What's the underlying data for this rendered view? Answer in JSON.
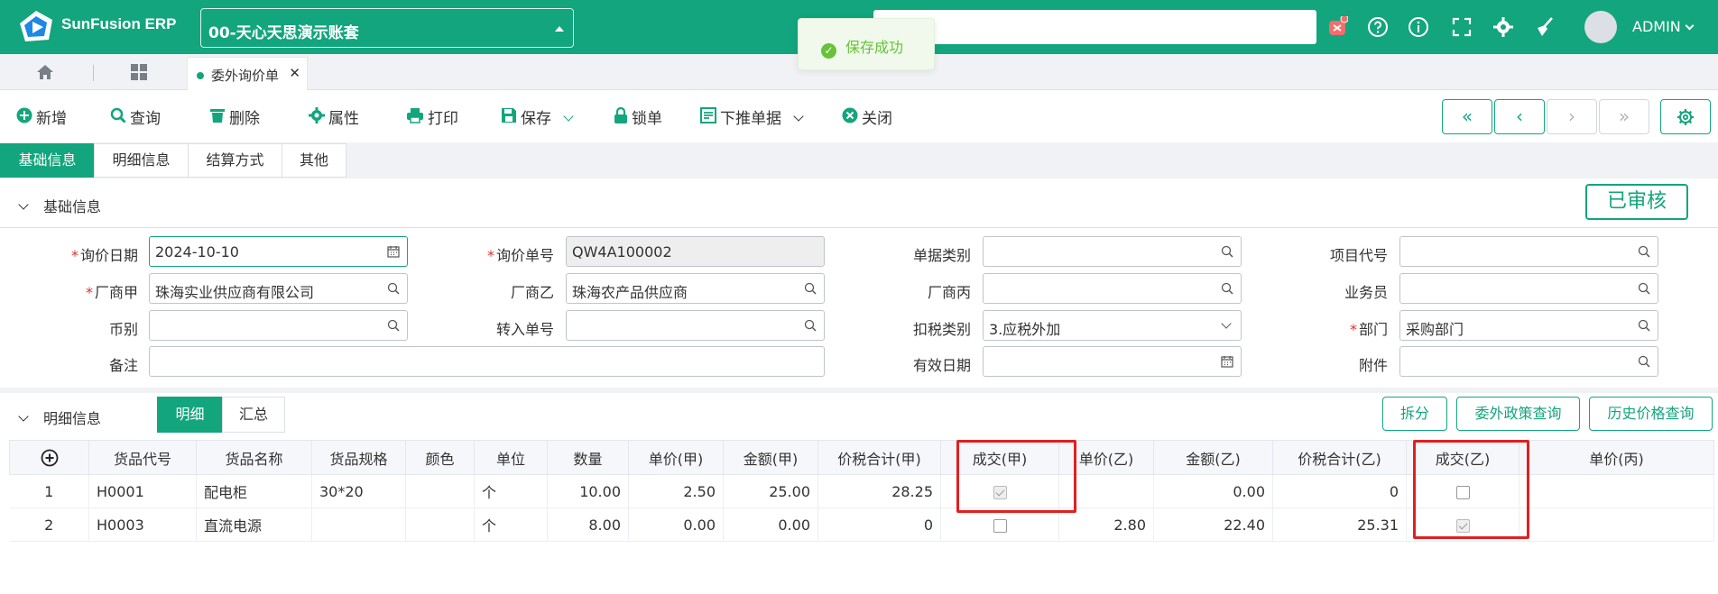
{
  "app": {
    "brand": "SunFusion ERP",
    "account": "00-天心天思演示账套",
    "user": "ADMIN"
  },
  "toast": {
    "message": "保存成功"
  },
  "tabs": {
    "doc_tab": "委外询价单"
  },
  "toolbar": {
    "new": "新增",
    "query": "查询",
    "delete": "删除",
    "props": "属性",
    "print": "打印",
    "save": "保存",
    "lock": "锁单",
    "push": "下推单据",
    "close": "关闭"
  },
  "subtabs": [
    "基础信息",
    "明细信息",
    "结算方式",
    "其他"
  ],
  "basic": {
    "header": "基础信息",
    "status": "已审核",
    "labels": {
      "date": "询价日期",
      "no": "询价单号",
      "doc_type": "单据类别",
      "project": "项目代号",
      "vendor_a": "厂商甲",
      "vendor_b": "厂商乙",
      "vendor_c": "厂商丙",
      "clerk": "业务员",
      "currency": "币别",
      "transfer_no": "转入单号",
      "tax_type": "扣税类别",
      "dept": "部门",
      "remark": "备注",
      "valid_date": "有效日期",
      "attach": "附件"
    },
    "values": {
      "date": "2024-10-10",
      "no": "QW4A100002",
      "doc_type": "",
      "project": "",
      "vendor_a": "珠海实业供应商有限公司",
      "vendor_b": "珠海农产品供应商",
      "vendor_c": "",
      "clerk": "",
      "currency": "",
      "transfer_no": "",
      "tax_type": "3.应税外加",
      "dept": "采购部门",
      "remark": "",
      "valid_date": "",
      "attach": ""
    }
  },
  "detail": {
    "header": "明细信息",
    "seg": [
      "明细",
      "汇总"
    ],
    "buttons": {
      "split": "拆分",
      "policy": "委外政策查询",
      "history": "历史价格查询"
    },
    "columns": [
      "货品代号",
      "货品名称",
      "货品规格",
      "颜色",
      "单位",
      "数量",
      "单价(甲)",
      "金额(甲)",
      "价税合计(甲)",
      "成交(甲)",
      "单价(乙)",
      "金额(乙)",
      "价税合计(乙)",
      "成交(乙)",
      "单价(丙)"
    ],
    "rows": [
      {
        "idx": "1",
        "code": "H0001",
        "name": "配电柜",
        "spec": "30*20",
        "color": "",
        "unit": "个",
        "qty": "10.00",
        "price_a": "2.50",
        "amt_a": "25.00",
        "total_a": "28.25",
        "deal_a": true,
        "price_b": "",
        "amt_b": "0.00",
        "total_b": "0",
        "deal_b": false,
        "price_c": ""
      },
      {
        "idx": "2",
        "code": "H0003",
        "name": "直流电源",
        "spec": "",
        "color": "",
        "unit": "个",
        "qty": "8.00",
        "price_a": "0.00",
        "amt_a": "0.00",
        "total_a": "0",
        "deal_a": false,
        "price_b": "2.80",
        "amt_b": "22.40",
        "total_b": "25.31",
        "deal_b": true,
        "price_c": ""
      }
    ]
  }
}
